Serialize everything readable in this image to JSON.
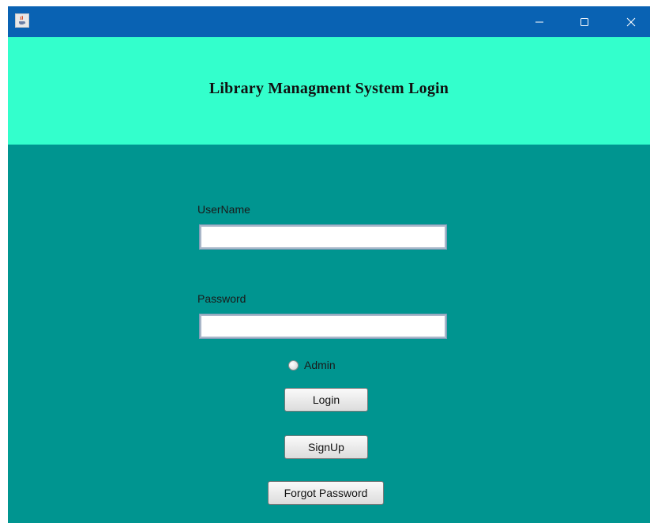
{
  "window": {
    "controls": {
      "minimize_icon": "minimize-icon",
      "maximize_icon": "maximize-icon",
      "close_icon": "close-icon"
    },
    "app_icon": "java-cup-icon"
  },
  "header": {
    "title": "Library Managment System Login",
    "background": "#33ffcc"
  },
  "form": {
    "background": "#009590",
    "username_label": "UserName",
    "username_value": "",
    "password_label": "Password",
    "password_value": "",
    "admin_label": "Admin",
    "admin_checked": false,
    "login_label": "Login",
    "signup_label": "SignUp",
    "forgot_label": "Forgot Password"
  },
  "colors": {
    "titlebar": "#0962b3"
  }
}
